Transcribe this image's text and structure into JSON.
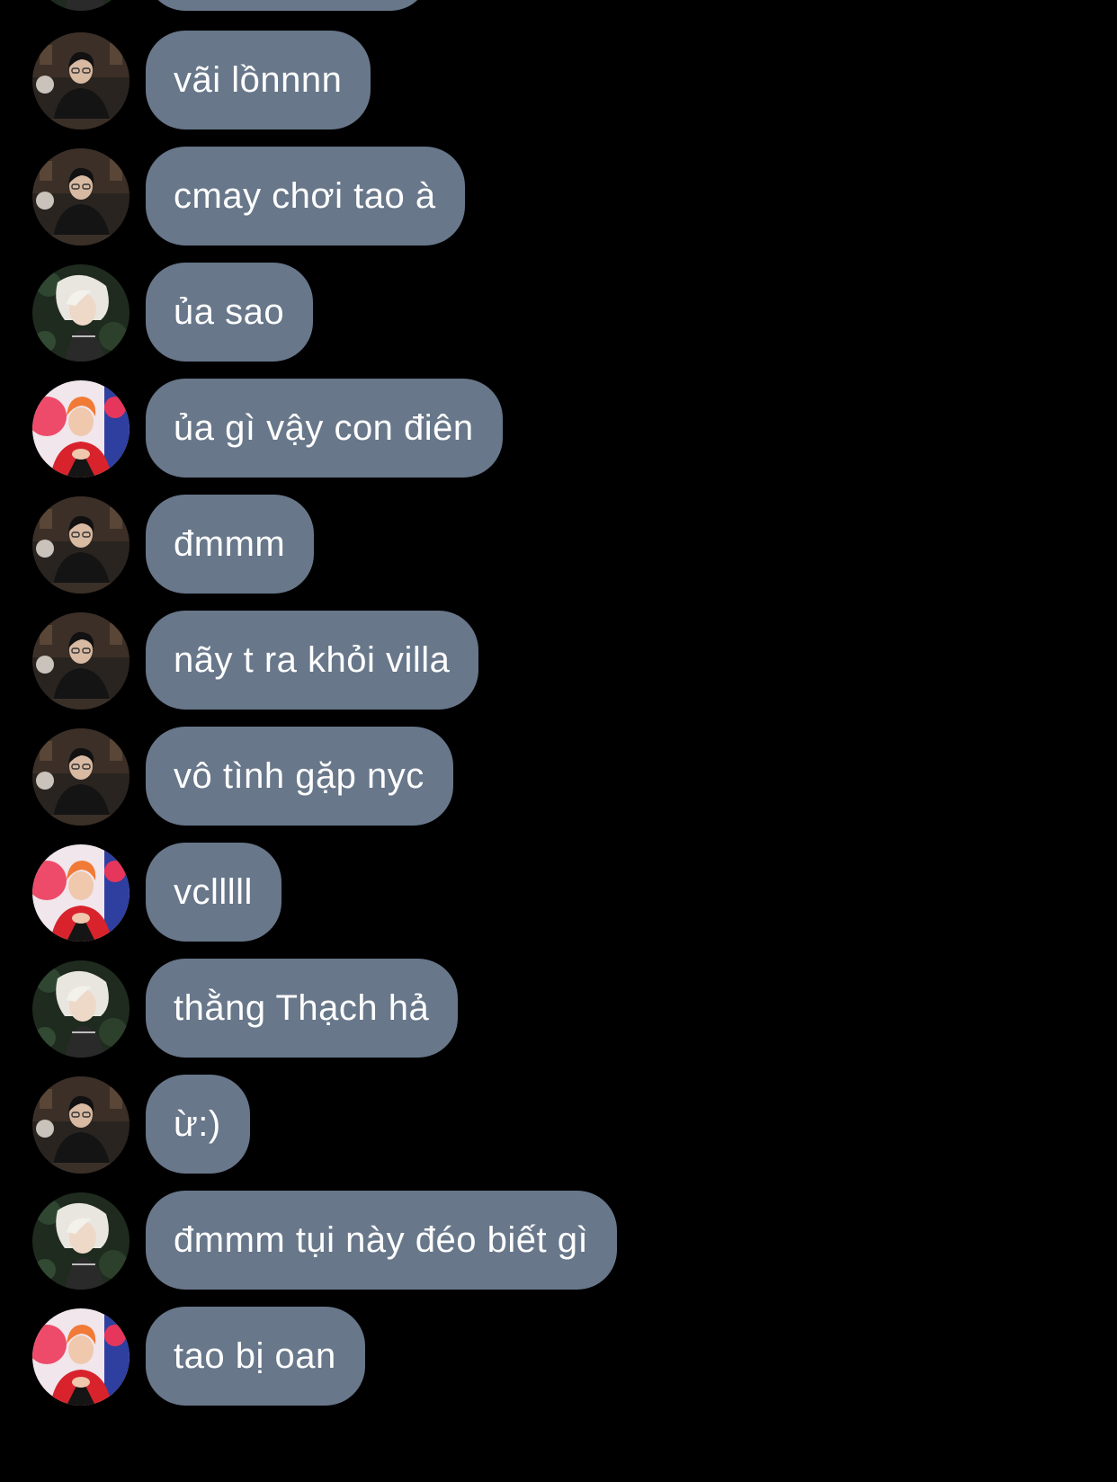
{
  "messages": [
    {
      "sender": "a",
      "text": "vãi lồnnnn"
    },
    {
      "sender": "a",
      "text": "cmay chơi tao à"
    },
    {
      "sender": "b",
      "text": "ủa sao"
    },
    {
      "sender": "c",
      "text": "ủa gì vậy con điên"
    },
    {
      "sender": "a",
      "text": "đmmm"
    },
    {
      "sender": "a",
      "text": "nãy t ra khỏi villa"
    },
    {
      "sender": "a",
      "text": "vô tình gặp nyc"
    },
    {
      "sender": "c",
      "text": "vclllll"
    },
    {
      "sender": "b",
      "text": "thằng Thạch hả"
    },
    {
      "sender": "a",
      "text": "ừ:)"
    },
    {
      "sender": "b",
      "text": "đmmm tụi này đéo biết gì"
    },
    {
      "sender": "c",
      "text": "tao bị oan"
    }
  ],
  "colors": {
    "background": "#000000",
    "bubble": "#68778a",
    "bubble_text": "#ffffff"
  }
}
